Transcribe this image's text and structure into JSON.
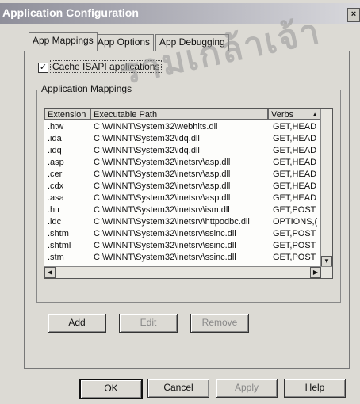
{
  "window": {
    "title": "Application Configuration",
    "close_glyph": "×"
  },
  "tabs": [
    {
      "label": "App Mappings",
      "active": true
    },
    {
      "label": "App Options",
      "active": false
    },
    {
      "label": "App Debugging",
      "active": false
    }
  ],
  "cache_checkbox": {
    "label": "Cache ISAPI applications",
    "checked": true,
    "glyph": "✓"
  },
  "group_label": "Application Mappings",
  "list": {
    "columns": [
      "Extension",
      "Executable Path",
      "Verbs"
    ],
    "sort_glyph": "▲",
    "rows": [
      [
        ".htw",
        "C:\\WINNT\\System32\\webhits.dll",
        "GET,HEAD"
      ],
      [
        ".ida",
        "C:\\WINNT\\System32\\idq.dll",
        "GET,HEAD"
      ],
      [
        ".idq",
        "C:\\WINNT\\System32\\idq.dll",
        "GET,HEAD"
      ],
      [
        ".asp",
        "C:\\WINNT\\System32\\inetsrv\\asp.dll",
        "GET,HEAD"
      ],
      [
        ".cer",
        "C:\\WINNT\\System32\\inetsrv\\asp.dll",
        "GET,HEAD"
      ],
      [
        ".cdx",
        "C:\\WINNT\\System32\\inetsrv\\asp.dll",
        "GET,HEAD"
      ],
      [
        ".asa",
        "C:\\WINNT\\System32\\inetsrv\\asp.dll",
        "GET,HEAD"
      ],
      [
        ".htr",
        "C:\\WINNT\\System32\\inetsrv\\ism.dll",
        "GET,POST"
      ],
      [
        ".idc",
        "C:\\WINNT\\System32\\inetsrv\\httpodbc.dll",
        "OPTIONS,("
      ],
      [
        ".shtm",
        "C:\\WINNT\\System32\\inetsrv\\ssinc.dll",
        "GET,POST"
      ],
      [
        ".shtml",
        "C:\\WINNT\\System32\\inetsrv\\ssinc.dll",
        "GET,POST"
      ],
      [
        ".stm",
        "C:\\WINNT\\System32\\inetsrv\\ssinc.dll",
        "GET,POST"
      ]
    ]
  },
  "buttons": {
    "add": "Add",
    "edit": "Edit",
    "remove": "Remove",
    "ok": "OK",
    "cancel": "Cancel",
    "apply": "Apply",
    "help": "Help"
  },
  "watermark": "รามเกล้าเจ้า"
}
